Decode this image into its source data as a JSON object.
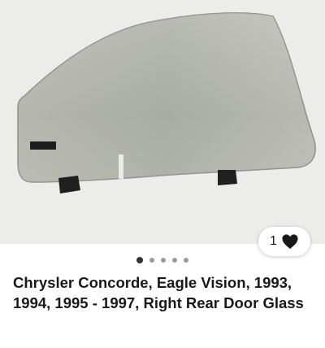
{
  "listing": {
    "title": "Chrysler Concorde, Eagle Vision, 1993, 1994, 1995 - 1997, Right Rear Door Glass",
    "image_alt": "Right rear door glass panel",
    "watch_count": "1",
    "watch_icon": "heart-icon",
    "carousel": {
      "total_images": 5,
      "active_index": 0
    }
  },
  "colors": {
    "image_background": "#ececeb",
    "text": "#191919",
    "active_dot": "#333333",
    "inactive_dot": "#9a9a9a"
  }
}
